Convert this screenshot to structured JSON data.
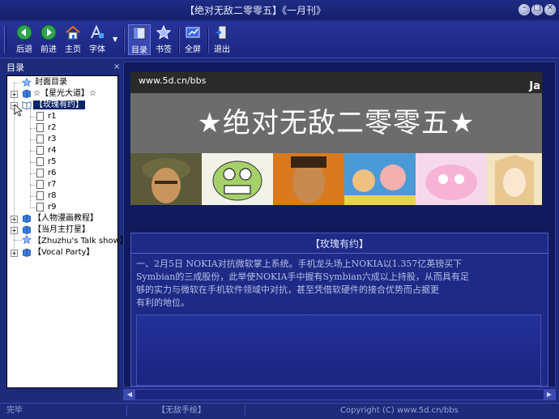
{
  "window": {
    "title": "【绝对无敌二零零五】《一月刊》",
    "controls": [
      "minimize",
      "maximize",
      "close"
    ]
  },
  "toolbar": {
    "back": "后退",
    "forward": "前进",
    "home": "主页",
    "font": "字体",
    "toc": "目录",
    "bookmark": "书签",
    "fullscreen": "全屏",
    "exit": "退出"
  },
  "sidebar": {
    "header": "目录",
    "items": [
      {
        "label": "封面目录"
      },
      {
        "label": "☆【星光大道】☆"
      },
      {
        "label": "【玫瑰有约】"
      },
      {
        "label": "r1"
      },
      {
        "label": "r2"
      },
      {
        "label": "r3"
      },
      {
        "label": "r4"
      },
      {
        "label": "r5"
      },
      {
        "label": "r6"
      },
      {
        "label": "r7"
      },
      {
        "label": "r8"
      },
      {
        "label": "r9"
      },
      {
        "label": "【人物漫画教程】"
      },
      {
        "label": "【当月主打星】"
      },
      {
        "label": "【Zhuzhu's Talk show】"
      },
      {
        "label": "【Vocal Party】"
      }
    ]
  },
  "banner": {
    "url": "www.5d.cn/bbs",
    "title": "★绝对无敌二零零五★",
    "corner": "Ja"
  },
  "article": {
    "title": "【玫瑰有约】",
    "line1": "一、2月5日 NOKIA对抗微软掌上系统。手机龙头场上NOKIA以1.357亿英镑买下",
    "line2": "Symbian的三成股份，此举使NOKIA手中握有Symbian六成以上持股，从而具有足",
    "line3": "够的实力与微软在手机软件领域中对抗，甚至凭借软硬件的接合优势而占据更",
    "line4": "有利的地位。"
  },
  "status": {
    "left": "完毕",
    "middle": "【无敌手绘】",
    "right": "Copyright (C) www.5d.cn/bbs"
  },
  "colors": {
    "frame": "#1c2b7a",
    "selection": "#0a246a",
    "banner_gray": "#6c6c6c"
  }
}
